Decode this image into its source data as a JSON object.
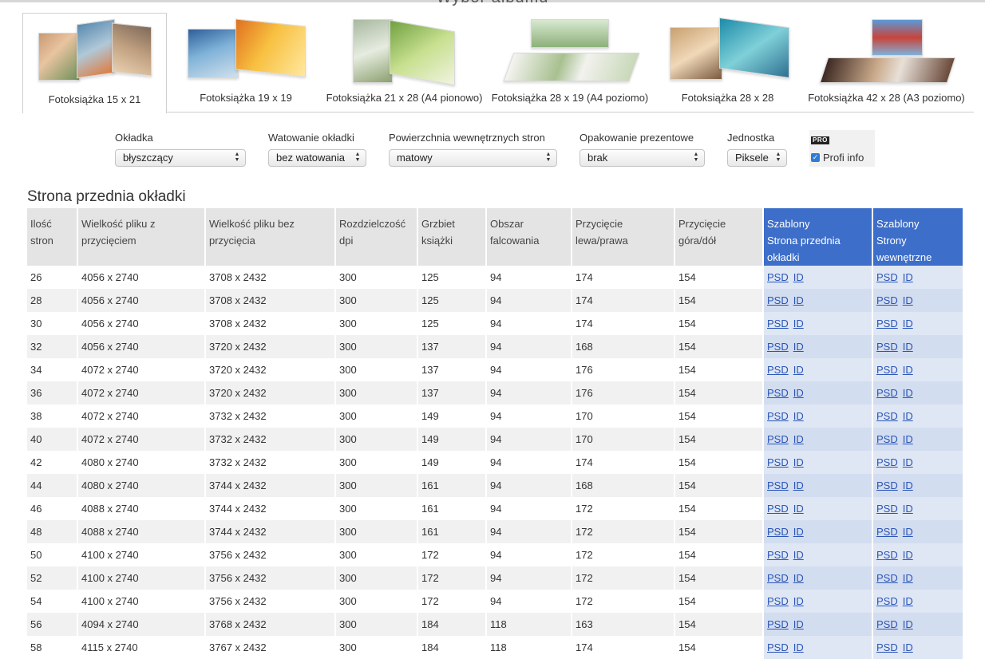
{
  "header": {
    "title": "Wybór albumu"
  },
  "tabs": [
    {
      "label": "Fotoksiążka 15 x 21",
      "active": true
    },
    {
      "label": "Fotoksiążka 19 x 19",
      "active": false
    },
    {
      "label": "Fotoksiążka 21 x 28 (A4 pionowo)",
      "active": false
    },
    {
      "label": "Fotoksiążka 28 x 19 (A4 poziomo)",
      "active": false
    },
    {
      "label": "Fotoksiążka 28 x 28",
      "active": false
    },
    {
      "label": "Fotoksiążka 42 x 28 (A3 poziomo)",
      "active": false
    }
  ],
  "filters": {
    "cover": {
      "label": "Okładka",
      "value": "błyszczący"
    },
    "padding": {
      "label": "Watowanie okładki",
      "value": "bez watowania"
    },
    "surface": {
      "label": "Powierzchnia wewnętrznych stron",
      "value": "matowy"
    },
    "gift": {
      "label": "Opakowanie prezentowe",
      "value": "brak"
    },
    "unit": {
      "label": "Jednostka",
      "value": "Piksele"
    },
    "pro": {
      "badge": "PRO",
      "label": "Profi info",
      "checked": true
    }
  },
  "section": {
    "title": "Strona przednia okładki"
  },
  "table": {
    "headers": {
      "pages": [
        "Ilość",
        "stron"
      ],
      "size_bleed": [
        "Wielkość pliku z",
        "przycięciem"
      ],
      "size_nobleed": [
        "Wielkość pliku bez",
        "przycięcia"
      ],
      "dpi": [
        "Rozdzielczość",
        "dpi"
      ],
      "spine": [
        "Grzbiet",
        "książki"
      ],
      "fold": [
        "Obszar",
        "falcowania"
      ],
      "trim_lr": [
        "Przycięcie",
        "lewa/prawa"
      ],
      "trim_tb": [
        "Przycięcie",
        "góra/dół"
      ],
      "tpl_cover": [
        "Szablony",
        "Strona przednia",
        "okładki"
      ],
      "tpl_inner": [
        "Szablony",
        "Strony",
        "wewnętrzne"
      ]
    },
    "link_psd": "PSD",
    "link_id": "ID",
    "rows": [
      [
        "26",
        "4056 x 2740",
        "3708 x 2432",
        "300",
        "125",
        "94",
        "174",
        "154"
      ],
      [
        "28",
        "4056 x 2740",
        "3708 x 2432",
        "300",
        "125",
        "94",
        "174",
        "154"
      ],
      [
        "30",
        "4056 x 2740",
        "3708 x 2432",
        "300",
        "125",
        "94",
        "174",
        "154"
      ],
      [
        "32",
        "4056 x 2740",
        "3720 x 2432",
        "300",
        "137",
        "94",
        "168",
        "154"
      ],
      [
        "34",
        "4072 x 2740",
        "3720 x 2432",
        "300",
        "137",
        "94",
        "176",
        "154"
      ],
      [
        "36",
        "4072 x 2740",
        "3720 x 2432",
        "300",
        "137",
        "94",
        "176",
        "154"
      ],
      [
        "38",
        "4072 x 2740",
        "3732 x 2432",
        "300",
        "149",
        "94",
        "170",
        "154"
      ],
      [
        "40",
        "4072 x 2740",
        "3732 x 2432",
        "300",
        "149",
        "94",
        "170",
        "154"
      ],
      [
        "42",
        "4080 x 2740",
        "3732 x 2432",
        "300",
        "149",
        "94",
        "174",
        "154"
      ],
      [
        "44",
        "4080 x 2740",
        "3744 x 2432",
        "300",
        "161",
        "94",
        "168",
        "154"
      ],
      [
        "46",
        "4088 x 2740",
        "3744 x 2432",
        "300",
        "161",
        "94",
        "172",
        "154"
      ],
      [
        "48",
        "4088 x 2740",
        "3744 x 2432",
        "300",
        "161",
        "94",
        "172",
        "154"
      ],
      [
        "50",
        "4100 x 2740",
        "3756 x 2432",
        "300",
        "172",
        "94",
        "172",
        "154"
      ],
      [
        "52",
        "4100 x 2740",
        "3756 x 2432",
        "300",
        "172",
        "94",
        "172",
        "154"
      ],
      [
        "54",
        "4100 x 2740",
        "3756 x 2432",
        "300",
        "172",
        "94",
        "172",
        "154"
      ],
      [
        "56",
        "4094 x 2740",
        "3768 x 2432",
        "300",
        "184",
        "118",
        "163",
        "154"
      ],
      [
        "58",
        "4115 x 2740",
        "3767 x 2432",
        "300",
        "184",
        "118",
        "174",
        "154"
      ]
    ]
  },
  "colors": {
    "template_header": "#3d6ec9",
    "template_cell": "#dfe7f5",
    "link": "#2a55b6",
    "header_gray": "#e4e4e4"
  }
}
